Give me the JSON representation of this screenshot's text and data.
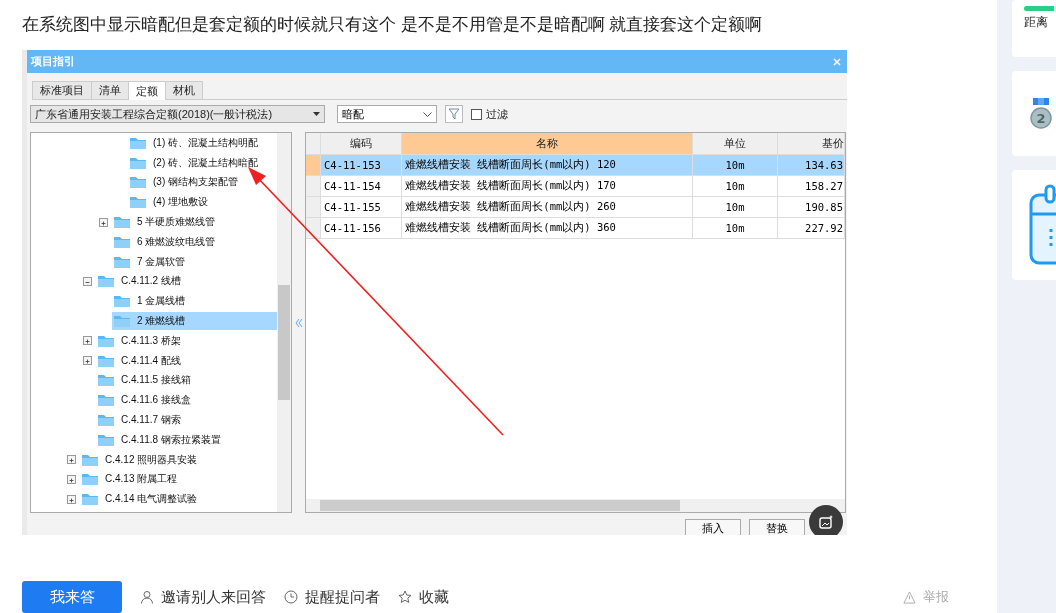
{
  "question": "在系统图中显示暗配但是套定额的时候就只有这个 是不是不用管是不是暗配啊 就直接套这个定额啊",
  "window": {
    "title": "项目指引",
    "tabs": [
      {
        "label": "标准项目",
        "selected": false
      },
      {
        "label": "清单",
        "selected": false
      },
      {
        "label": "定额",
        "selected": true
      },
      {
        "label": "材机",
        "selected": false
      }
    ],
    "quota_select": "广东省通用安装工程综合定额(2018)(一般计税法)",
    "type_select": "暗配",
    "filter": {
      "label": "过滤",
      "checked": false
    },
    "tree": [
      {
        "children": [
          {
            "children": [
              {
                "children": [
                  {
                    "label": "(1) 砖、混凝土结构明配",
                    "selected": false
                  },
                  {
                    "label": "(2) 砖、混凝土结构暗配",
                    "selected": false
                  },
                  {
                    "label": "(3) 钢结构支架配管",
                    "selected": false
                  },
                  {
                    "label": "(4) 埋地敷设",
                    "selected": false
                  }
                ]
              },
              {
                "label": "5 半硬质难燃线管",
                "selected": false,
                "expanded": false
              },
              {
                "label": "6 难燃波纹电线管",
                "selected": false
              },
              {
                "label": "7 金属软管",
                "selected": false
              }
            ]
          },
          {
            "label": "C.4.11.2 线槽",
            "selected": false,
            "expanded": true,
            "children": [
              {
                "label": "1 金属线槽",
                "selected": false
              },
              {
                "label": "2 难燃线槽",
                "selected": true
              }
            ]
          },
          {
            "label": "C.4.11.3 桥架",
            "selected": false,
            "expanded": false
          },
          {
            "label": "C.4.11.4 配线",
            "selected": false,
            "expanded": false
          },
          {
            "label": "C.4.11.5 接线箱",
            "selected": false
          },
          {
            "label": "C.4.11.6 接线盒",
            "selected": false
          },
          {
            "label": "C.4.11.7 钢索",
            "selected": false
          },
          {
            "label": "C.4.11.8 钢索拉紧装置",
            "selected": false
          }
        ]
      },
      {
        "label": "C.4.12 照明器具安装",
        "selected": false,
        "expanded": false
      },
      {
        "label": "C.4.13 附属工程",
        "selected": false,
        "expanded": false
      },
      {
        "label": "C.4.14 电气调整试验",
        "selected": false,
        "expanded": false
      }
    ],
    "columns": [
      {
        "label": "编码",
        "highlighted": false
      },
      {
        "label": "名称",
        "highlighted": true
      },
      {
        "label": "单位",
        "highlighted": false
      },
      {
        "label": "基价",
        "highlighted": false
      }
    ],
    "rows": [
      {
        "code": "C4-11-153",
        "name": "难燃线槽安装 线槽断面周长(mm以内) 120",
        "unit": "10m",
        "price": "134.63",
        "selected": true
      },
      {
        "code": "C4-11-154",
        "name": "难燃线槽安装 线槽断面周长(mm以内) 170",
        "unit": "10m",
        "price": "158.27",
        "selected": false
      },
      {
        "code": "C4-11-155",
        "name": "难燃线槽安装 线槽断面周长(mm以内) 260",
        "unit": "10m",
        "price": "190.85",
        "selected": false
      },
      {
        "code": "C4-11-156",
        "name": "难燃线槽安装 线槽断面周长(mm以内) 360",
        "unit": "10m",
        "price": "227.92",
        "selected": false
      }
    ],
    "buttons": [
      "插入",
      "替换"
    ]
  },
  "actions": {
    "answer": "我来答",
    "invite": "邀请别人来回答",
    "remind": "提醒提问者",
    "favorite": "收藏",
    "report": "举报"
  },
  "sidebar": {
    "countdown_label": "距离",
    "countdown_progress": {
      "level": 0.5
    },
    "medal_rank": "2"
  }
}
